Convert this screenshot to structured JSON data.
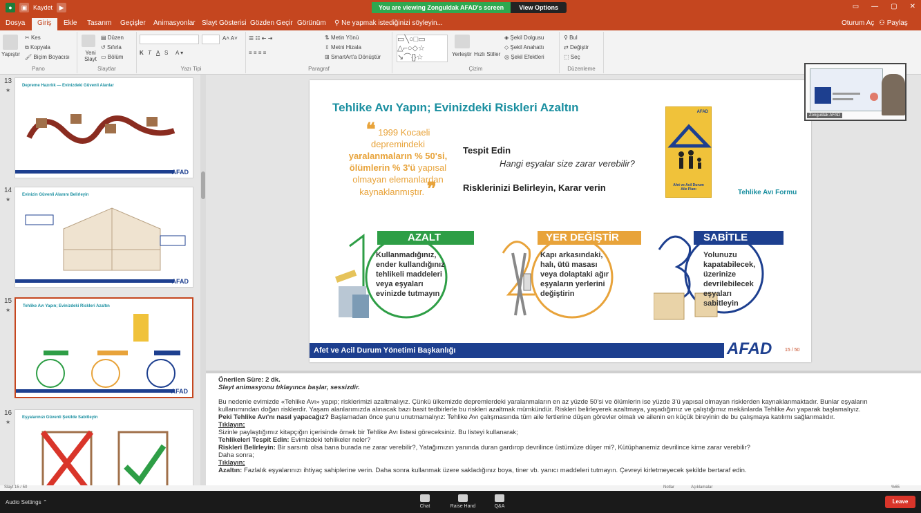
{
  "titlebar": {
    "quick_access_label": "Kaydet",
    "zoom_banner": "You are viewing Zonguldak AFAD's screen",
    "view_options": "View Options",
    "window_controls": [
      "▭",
      "—",
      "▢",
      "✕"
    ]
  },
  "menu": {
    "tabs": [
      "Dosya",
      "Giriş",
      "Ekle",
      "Tasarım",
      "Geçişler",
      "Animasyonlar",
      "Slayt Gösterisi",
      "Gözden Geçir",
      "Görünüm"
    ],
    "active": "Giriş",
    "tellme": "Ne yapmak istediğinizi söyleyin...",
    "signin": "Oturum Aç",
    "share": "Paylaş"
  },
  "ribbon": {
    "pano": {
      "label": "Pano",
      "paste": "Yapıştır",
      "cut": "Kes",
      "copy": "Kopyala",
      "format_painter": "Biçim Boyacısı"
    },
    "slaytlar": {
      "label": "Slaytlar",
      "new_slide": "Yeni Slayt",
      "layout": "Düzen",
      "reset": "Sıfırla",
      "section": "Bölüm"
    },
    "yazi_tipi": {
      "label": "Yazı Tipi"
    },
    "paragraf": {
      "label": "Paragraf",
      "text_direction": "Metin Yönü",
      "align_text": "Metni Hizala",
      "smartart": "SmartArt'a Dönüştür"
    },
    "cizim": {
      "label": "Çizim",
      "arrange": "Yerleştir",
      "quick_styles": "Hızlı Stiller",
      "shape_fill": "Şekil Dolgusu",
      "shape_outline": "Şekil Anahattı",
      "shape_effects": "Şekil Efektleri"
    },
    "duzenleme": {
      "label": "Düzenleme",
      "find": "Bul",
      "replace": "Değiştir",
      "select": "Seç"
    }
  },
  "thumbnails": [
    {
      "num": "13",
      "title": "Depreme Hazırlık — Evinizdeki Güvenli Alanlar",
      "logo": "AFAD"
    },
    {
      "num": "14",
      "title": "Evinizin Güvenli Alanını Belirleyin",
      "logo": "AFAD"
    },
    {
      "num": "15",
      "title": "Tehlike Avı Yapın; Evinizdeki Riskleri Azaltın",
      "logo": "AFAD"
    },
    {
      "num": "16",
      "title": "Eşyalarınızı Güvenli Şekilde Sabitleyin",
      "logo": "AFAD"
    }
  ],
  "slide": {
    "title": "Tehlike Avı Yapın; Evinizdeki Riskleri Azaltın",
    "quote_line1": "1999 Kocaeli",
    "quote_line2": "depremindeki",
    "quote_bold1": "yaralanmaların % 50'si,",
    "quote_bold2": "ölümlerin % 3'ü",
    "quote_line3": "yapısal",
    "quote_line4": "olmayan elemanlardan",
    "quote_line5": "kaynaklanmıştır.",
    "tespit": "Tespit Edin",
    "hangi": "Hangi eşyalar size zarar verebilir?",
    "risk": "Risklerinizi Belirleyin, Karar verin",
    "book_logo": "AFAD",
    "book_title": "Afet ve Acil Durum Aile Planı",
    "form_label": "Tehlike Avı Formu",
    "steps": [
      {
        "num": "1",
        "title": "AZALT",
        "color": "#2e9e46",
        "text": "Kullanmadığınız, ender kullandığınız tehlikeli maddeleri veya eşyaları evinizde tutmayın"
      },
      {
        "num": "2",
        "title": "YER DEĞİŞTİR",
        "color": "#e8a33a",
        "text": "Kapı arkasındaki, halı, ütü masası veya dolaptaki ağır eşyaların yerlerini değiştirin"
      },
      {
        "num": "3",
        "title": "SABİTLE",
        "color": "#1d3f8f",
        "text": "Yolunuzu kapatabilecek, üzerinize devrilebilecek eşyaları sabitleyin"
      }
    ],
    "footer": "Afet ve Acil Durum Yönetimi Başkanlığı",
    "logo": "AFAD",
    "page": "15 / 50"
  },
  "notes": {
    "duration": "Önerilen Süre: 2 dk.",
    "intro": "Slayt animasyonu tıklayınca başlar, sessizdir.",
    "p1": "Bu nedenle evimizde «Tehlike Avı» yapıp; risklerimizi azaltmalıyız. Çünkü ülkemizde depremlerdeki yaralanmaların en az yüzde 50'si ve ölümlerin ise yüzde 3'ü yapısal olmayan risklerden kaynaklanmaktadır. Bunlar eşyaların kullanımından doğan risklerdir. Yaşam alanlarımızda alınacak bazı basit tedbirlerle bu riskleri azaltmak mümkündür. Riskleri belirleyerek azaltmaya, yaşadığımız ve çalıştığımız mekânlarda Tehlike Avı yaparak başlamalıyız.",
    "p2_bold": "Peki Tehlike Avı'nı nasıl yapacağız?",
    "p2": "Başlamadan önce şunu unutmamalıyız: Tehlike Avı çalışmasında tüm aile fertlerine düşen görevler olmalı ve ailenin en küçük bireyinin de bu çalışmaya katılımı sağlanmalıdır.",
    "click1": "Tıklayın;",
    "p3": "Sizinle paylaştığımız kitapçığın içerisinde örnek bir Tehlike Avı listesi göreceksiniz. Bu listeyi kullanarak;",
    "p4_bold": "Tehlikeleri Tespit Edin:",
    "p4": "Evimizdeki tehlikeler neler?",
    "p5_bold": "Riskleri Belirleyin:",
    "p5": "Bir sarsıntı olsa bana burada ne zarar verebilir?, Yatağımızın yanında duran gardırop devrilince üstümüze düşer mi?, Kütüphanemiz devrilince kime zarar verebilir?",
    "p6": "Daha sonra;",
    "click2": "Tıklayın;",
    "p7_bold": "Azaltın:",
    "p7": "Fazlalık eşyalarınızı ihtiyaç sahiplerine verin. Daha sonra kullanmak üzere sakladığınız boya, tiner vb. yanıcı maddeleri tutmayın. Çevreyi kirletmeyecek şekilde bertaraf edin."
  },
  "status": {
    "left": "Slayt 15 / 50",
    "notes": "Notlar",
    "comments": "Açıklamalar",
    "zoom": "%65"
  },
  "zoom_controls": {
    "audio": "Audio Settings",
    "chat": "Chat",
    "raise_hand": "Raise Hand",
    "qa": "Q&A",
    "leave": "Leave"
  },
  "camera": {
    "name": "Zonguldak AFAD"
  }
}
